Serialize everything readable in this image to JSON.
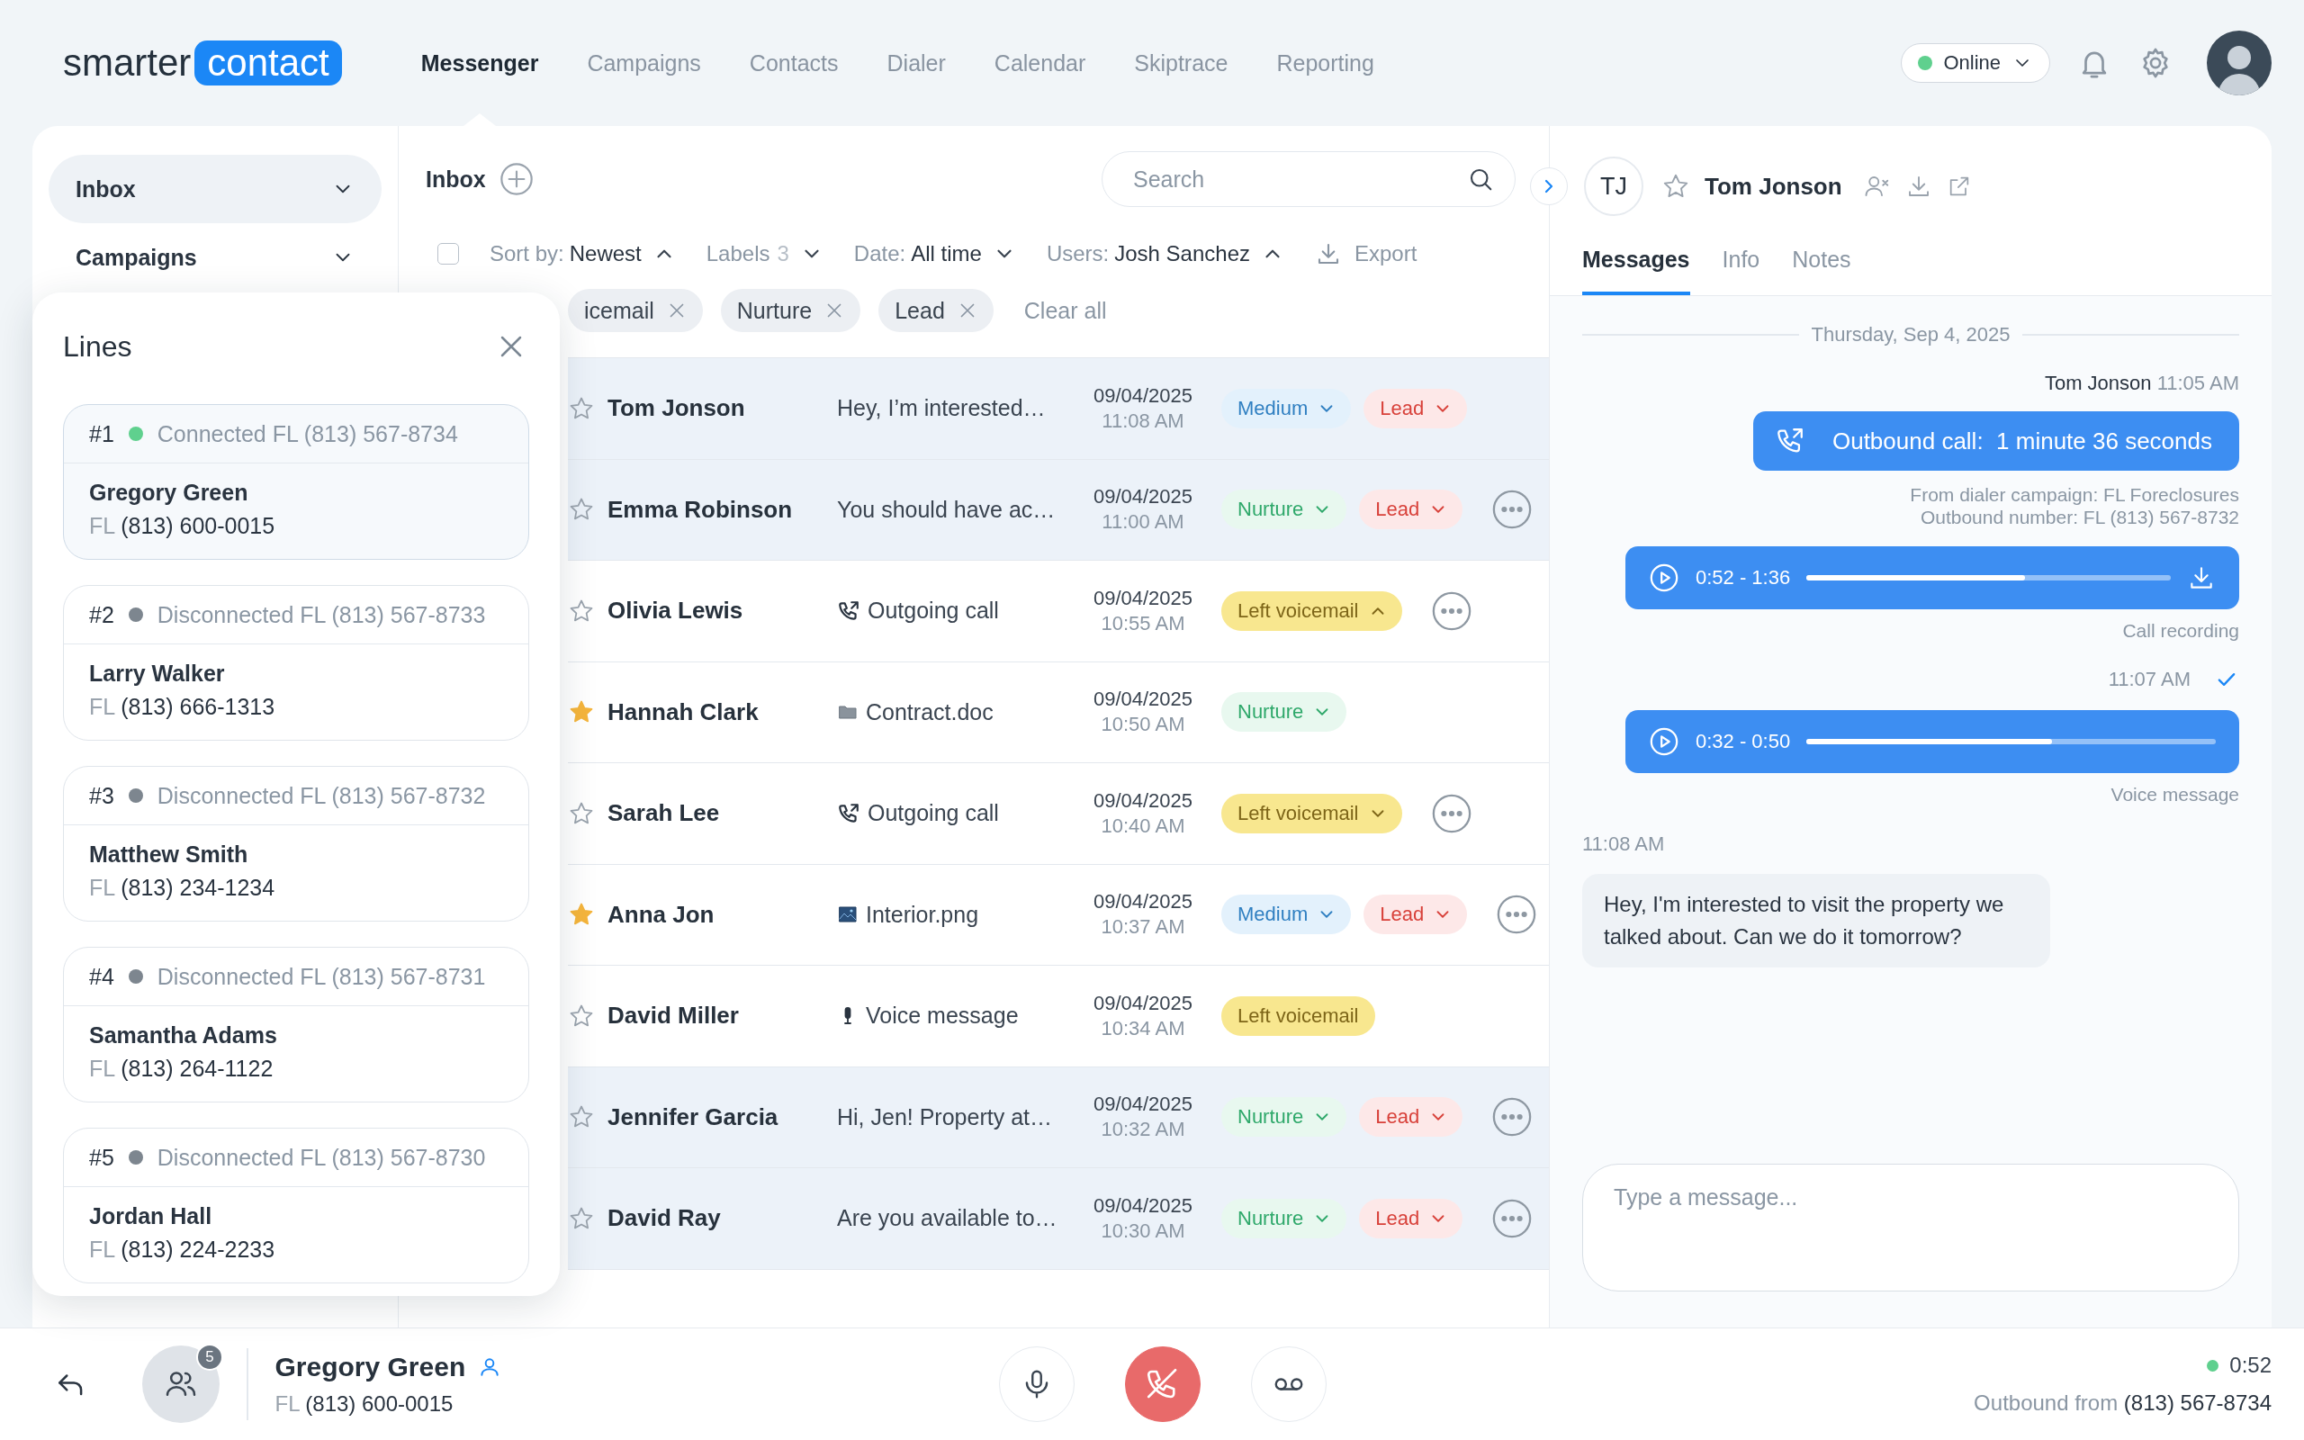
{
  "logo": {
    "word": "smarter",
    "badge": "contact"
  },
  "nav": [
    {
      "label": "Messenger",
      "selected": true
    },
    {
      "label": "Campaigns",
      "selected": false
    },
    {
      "label": "Contacts",
      "selected": false
    },
    {
      "label": "Dialer",
      "selected": false
    },
    {
      "label": "Calendar",
      "selected": false
    },
    {
      "label": "Skiptrace",
      "selected": false
    },
    {
      "label": "Reporting",
      "selected": false
    }
  ],
  "status_select": {
    "label": "Online",
    "online": true
  },
  "sidebar": {
    "items": [
      {
        "label": "Inbox",
        "selected": true
      },
      {
        "label": "Campaigns",
        "selected": false
      }
    ]
  },
  "lines_panel": {
    "title": "Lines",
    "lines": [
      {
        "number": "#1",
        "connected": true,
        "status": "Connected FL (813) 567-8734",
        "selected": true,
        "name": "Gregory Green",
        "region": "FL",
        "phone": "(813) 600-0015"
      },
      {
        "number": "#2",
        "connected": false,
        "status": "Disconnected FL (813) 567-8733",
        "selected": false,
        "name": "Larry Walker",
        "region": "FL",
        "phone": "(813) 666-1313"
      },
      {
        "number": "#3",
        "connected": false,
        "status": "Disconnected FL (813) 567-8732",
        "selected": false,
        "name": "Matthew Smith",
        "region": "FL",
        "phone": "(813) 234-1234"
      },
      {
        "number": "#4",
        "connected": false,
        "status": "Disconnected FL (813) 567-8731",
        "selected": false,
        "name": "Samantha Adams",
        "region": "FL",
        "phone": "(813) 264-1122"
      },
      {
        "number": "#5",
        "connected": false,
        "status": "Disconnected FL (813) 567-8730",
        "selected": false,
        "name": "Jordan Hall",
        "region": "FL",
        "phone": "(813) 224-2233"
      }
    ]
  },
  "inbox": {
    "title": "Inbox",
    "search": {
      "placeholder": "Search"
    },
    "select_all": {
      "checked": false
    },
    "filters": [
      {
        "label": "Sort by:",
        "value": "Newest",
        "expanded": true
      },
      {
        "label": "Labels",
        "count": "3",
        "expanded": false
      },
      {
        "label": "Date:",
        "value": "All time",
        "expanded": false
      },
      {
        "label": "Users:",
        "value": "Josh Sanchez",
        "expanded": true
      }
    ],
    "export": "Export",
    "chips": [
      "icemail",
      "Nurture",
      "Lead"
    ],
    "clear": "Clear all",
    "rows": [
      {
        "highlighted": true,
        "starred": false,
        "name": "Tom Jonson",
        "preview": {
          "kind": "text",
          "text": "Hey, I’m interested…"
        },
        "date": "09/04/2025",
        "time": "11:08 AM",
        "tags": [
          {
            "kind": "medium",
            "label": "Medium",
            "dropdown": true,
            "expanded": false
          },
          {
            "kind": "lead",
            "label": "Lead",
            "dropdown": true,
            "expanded": false
          }
        ],
        "more": false
      },
      {
        "highlighted": true,
        "starred": false,
        "name": "Emma Robinson",
        "preview": {
          "kind": "text",
          "text": "You should have ac…"
        },
        "date": "09/04/2025",
        "time": "11:00 AM",
        "tags": [
          {
            "kind": "nurture",
            "label": "Nurture",
            "dropdown": true,
            "expanded": false
          },
          {
            "kind": "lead",
            "label": "Lead",
            "dropdown": true,
            "expanded": false
          }
        ],
        "more": true
      },
      {
        "highlighted": false,
        "starred": false,
        "name": "Olivia Lewis",
        "preview": {
          "kind": "call",
          "text": "Outgoing call"
        },
        "date": "09/04/2025",
        "time": "10:55 AM",
        "tags": [
          {
            "kind": "voicemail",
            "label": "Left voicemail",
            "dropdown": true,
            "expanded": true
          }
        ],
        "more": true
      },
      {
        "highlighted": false,
        "starred": true,
        "name": "Hannah Clark",
        "preview": {
          "kind": "file",
          "text": "Contract.doc"
        },
        "date": "09/04/2025",
        "time": "10:50 AM",
        "tags": [
          {
            "kind": "nurture",
            "label": "Nurture",
            "dropdown": true,
            "expanded": false
          }
        ],
        "more": false
      },
      {
        "highlighted": false,
        "starred": false,
        "name": "Sarah Lee",
        "preview": {
          "kind": "call",
          "text": "Outgoing call"
        },
        "date": "09/04/2025",
        "time": "10:40 AM",
        "tags": [
          {
            "kind": "voicemail",
            "label": "Left voicemail",
            "dropdown": true,
            "expanded": false
          }
        ],
        "more": true
      },
      {
        "highlighted": false,
        "starred": true,
        "name": "Anna Jon",
        "preview": {
          "kind": "image",
          "text": "Interior.png"
        },
        "date": "09/04/2025",
        "time": "10:37 AM",
        "tags": [
          {
            "kind": "medium",
            "label": "Medium",
            "dropdown": true,
            "expanded": false
          },
          {
            "kind": "lead",
            "label": "Lead",
            "dropdown": true,
            "expanded": false
          }
        ],
        "more": true
      },
      {
        "highlighted": false,
        "starred": false,
        "name": "David Miller",
        "preview": {
          "kind": "voice",
          "text": "Voice message"
        },
        "date": "09/04/2025",
        "time": "10:34 AM",
        "tags": [
          {
            "kind": "voicemail",
            "label": "Left voicemail",
            "dropdown": false
          }
        ],
        "more": false
      },
      {
        "highlighted": true,
        "starred": false,
        "name": "Jennifer Garcia",
        "preview": {
          "kind": "text",
          "text": "Hi, Jen! Property at…"
        },
        "date": "09/04/2025",
        "time": "10:32 AM",
        "tags": [
          {
            "kind": "nurture",
            "label": "Nurture",
            "dropdown": true,
            "expanded": false
          },
          {
            "kind": "lead",
            "label": "Lead",
            "dropdown": true,
            "expanded": false
          }
        ],
        "more": true
      },
      {
        "highlighted": true,
        "starred": false,
        "name": "David Ray",
        "preview": {
          "kind": "text",
          "text": "Are you available to…"
        },
        "date": "09/04/2025",
        "time": "10:30 AM",
        "tags": [
          {
            "kind": "nurture",
            "label": "Nurture",
            "dropdown": true,
            "expanded": false
          },
          {
            "kind": "lead",
            "label": "Lead",
            "dropdown": true,
            "expanded": false
          }
        ],
        "more": true
      }
    ]
  },
  "contact": {
    "initials": "TJ",
    "starred": false,
    "name": "Tom Jonson",
    "tabs": [
      {
        "label": "Messages",
        "selected": true
      },
      {
        "label": "Info",
        "selected": false
      },
      {
        "label": "Notes",
        "selected": false
      }
    ],
    "date": "Thursday, Sep 4, 2025",
    "messages": [
      {
        "kind": "sender",
        "name": "Tom Jonson",
        "time": "11:05 AM"
      },
      {
        "kind": "call",
        "text": "Outbound call:  1 minute 36 seconds"
      },
      {
        "kind": "meta",
        "lines": [
          "From dialer campaign: FL Foreclosures",
          "Outbound number: FL (813) 567-8732"
        ]
      },
      {
        "kind": "audio",
        "range": "0:52 - 1:36",
        "level": 0.6,
        "download": true
      },
      {
        "kind": "caption",
        "text": "Call recording"
      },
      {
        "kind": "time",
        "text": "11:07 AM",
        "read": true
      },
      {
        "kind": "audio",
        "range": "0:32 - 0:50",
        "level": 0.6,
        "download": false
      },
      {
        "kind": "caption",
        "text": "Voice message"
      },
      {
        "kind": "stamp",
        "text": "11:08 AM"
      },
      {
        "kind": "incoming",
        "text": "Hey, I'm interested to visit the property we talked about. Can we do it tomorrow?"
      }
    ],
    "composer": {
      "placeholder": "Type a message..."
    }
  },
  "call_bar": {
    "participants": "5",
    "name": "Gregory Green",
    "region": "FL",
    "phone": "(813) 600-0015",
    "timer": "0:52",
    "outbound_label": "Outbound from",
    "outbound_number": "(813) 567-8734"
  }
}
